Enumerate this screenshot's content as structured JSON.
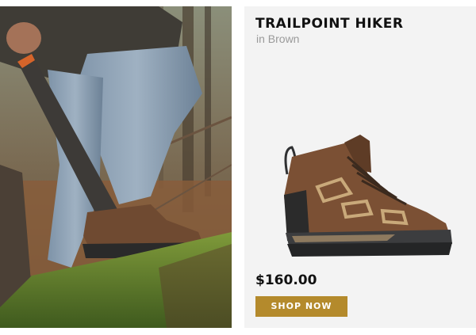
{
  "product": {
    "name": "TRAILPOINT HIKER",
    "color_variant": "in Brown",
    "price": "$160.00",
    "cta_label": "SHOP NOW"
  },
  "images": {
    "lifestyle": "lifestyle-photo-hiker-with-saw-on-mossy-log",
    "product": "brown-mid-hiking-boot-icon"
  },
  "colors": {
    "panel_background": "#f3f3f3",
    "cta_background": "#b48a2c",
    "cta_text": "#ffffff",
    "title_text": "#111111",
    "subtitle_text": "#9a9a9a",
    "boot_leather": "#7b5034",
    "boot_sole": "#2f3032"
  }
}
